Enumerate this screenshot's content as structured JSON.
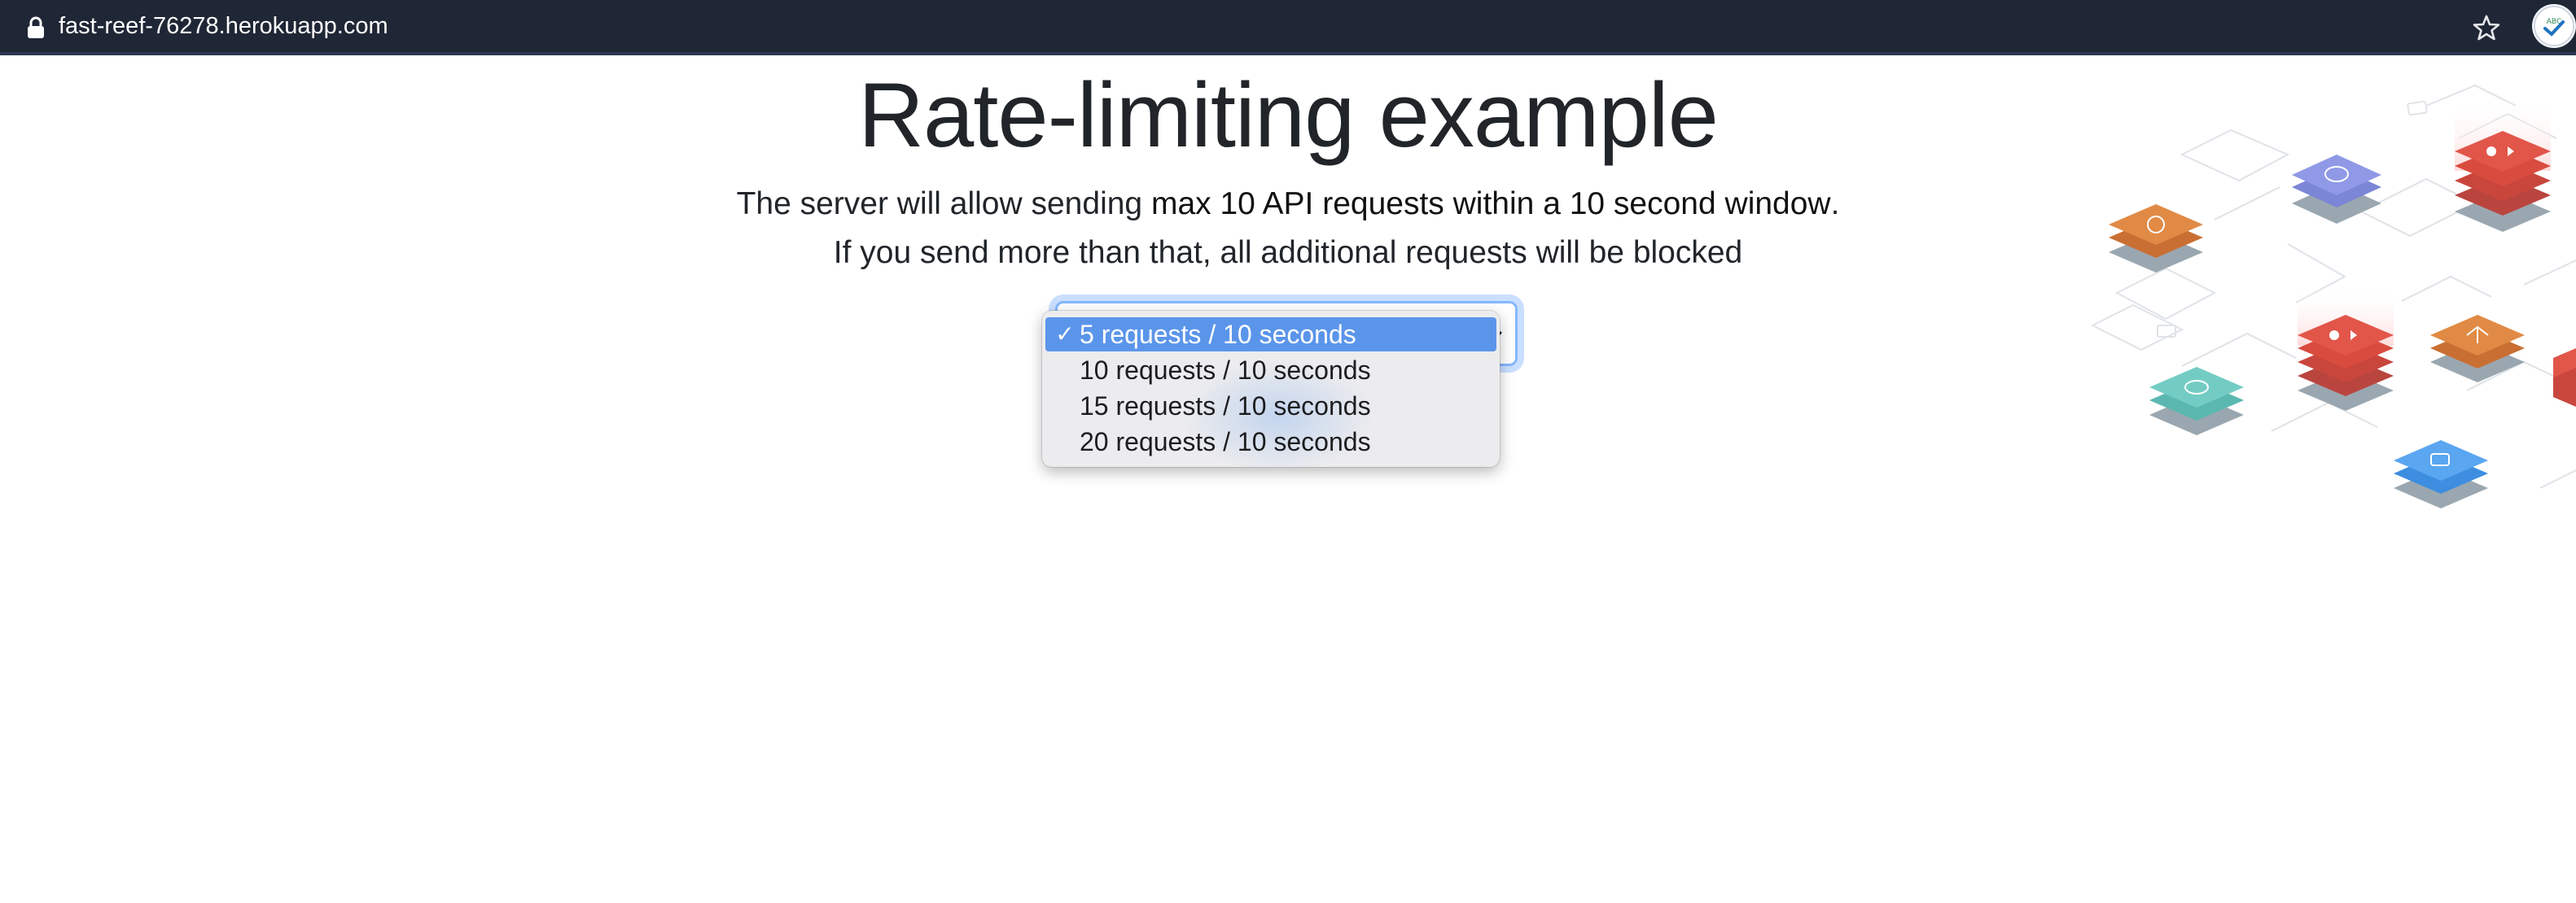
{
  "browser": {
    "url": "fast-reef-76278.herokuapp.com",
    "lock_icon": "lock-icon",
    "bookmark_icon": "star-icon",
    "extension_icon": "extension-badge-icon"
  },
  "main": {
    "title": "Rate-limiting example",
    "line1_prefix": "The server will allow sending ",
    "line1_strong": "max 10 API requests within a 10 second window",
    "line1_suffix": ".",
    "line2": "If you send more than that, all additional requests will be blocked"
  },
  "rate_select": {
    "selected_index": 0,
    "check_mark": "✓",
    "options": [
      "5 requests / 10 seconds",
      "10 requests / 10 seconds",
      "15 requests / 10 seconds",
      "20 requests / 10 seconds"
    ]
  },
  "colors": {
    "topbar_bg": "#1f2635",
    "selected_option_bg": "#5b95ea",
    "focus_ring": "#86b7fe",
    "text": "#212529"
  }
}
